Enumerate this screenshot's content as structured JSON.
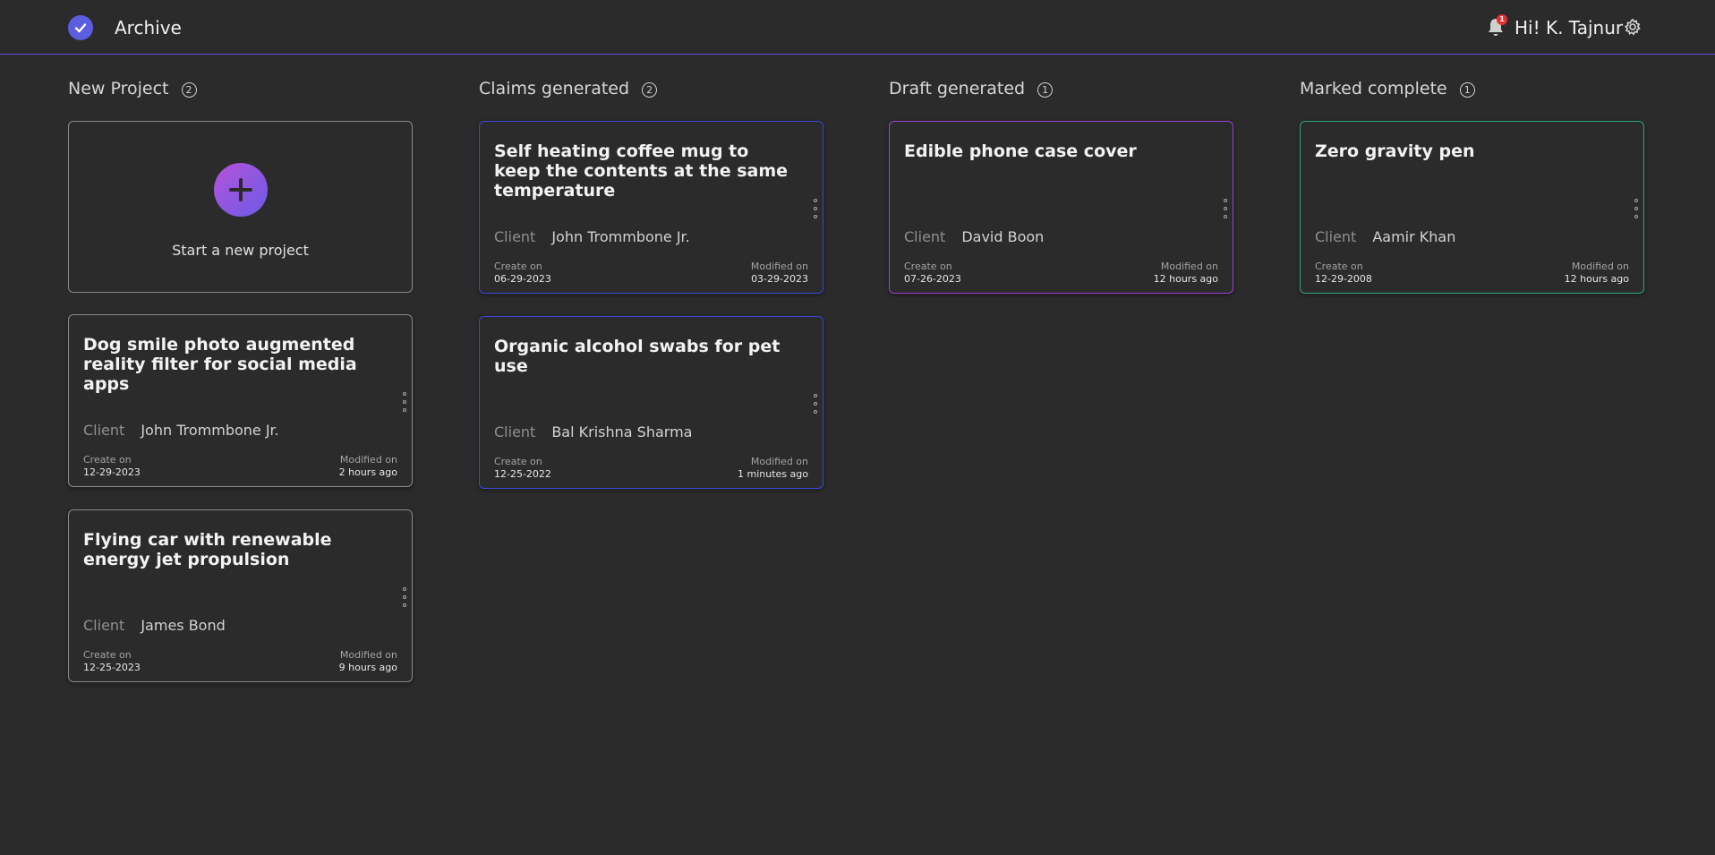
{
  "header": {
    "title": "Archive",
    "notification_count": "1",
    "greeting": "Hi! K. Tajnur",
    "accent_color": "#5a4fd8"
  },
  "new_project_tile": {
    "label": "Start a new project"
  },
  "columns": [
    {
      "title": "New Project",
      "count": "2",
      "cards": [
        {
          "title": "Dog smile photo augmented reality filter for social media apps",
          "client_label": "Client",
          "client": "John Trommbone Jr.",
          "created_label": "Create on",
          "created": "12-29-2023",
          "modified_label": "Modified on",
          "modified": "2 hours ago"
        },
        {
          "title": "Flying car with renewable energy jet propulsion",
          "client_label": "Client",
          "client": "James Bond",
          "created_label": "Create on",
          "created": "12-25-2023",
          "modified_label": "Modified on",
          "modified": "9 hours ago"
        }
      ]
    },
    {
      "title": "Claims generated",
      "count": "2",
      "border_color": "#3a48d8",
      "cards": [
        {
          "title": "Self heating coffee mug to keep the contents at the same temperature",
          "client_label": "Client",
          "client": "John Trommbone Jr.",
          "created_label": "Create on",
          "created": "06-29-2023",
          "modified_label": "Modified on",
          "modified": "03-29-2023"
        },
        {
          "title": "Organic alcohol swabs for pet use",
          "client_label": "Client",
          "client": "Bal Krishna Sharma",
          "created_label": "Create on",
          "created": "12-25-2022",
          "modified_label": "Modified on",
          "modified": "1 minutes ago"
        }
      ]
    },
    {
      "title": "Draft generated",
      "count": "1",
      "border_color": "#9b3fd6",
      "cards": [
        {
          "title": "Edible phone case cover",
          "client_label": "Client",
          "client": "David Boon",
          "created_label": "Create on",
          "created": "07-26-2023",
          "modified_label": "Modified on",
          "modified": "12 hours ago"
        }
      ]
    },
    {
      "title": "Marked complete",
      "count": "1",
      "border_color": "#2fa877",
      "cards": [
        {
          "title": "Zero gravity pen",
          "client_label": "Client",
          "client": "Aamir Khan",
          "created_label": "Create on",
          "created": "12-29-2008",
          "modified_label": "Modified on",
          "modified": "12 hours ago"
        }
      ]
    }
  ]
}
